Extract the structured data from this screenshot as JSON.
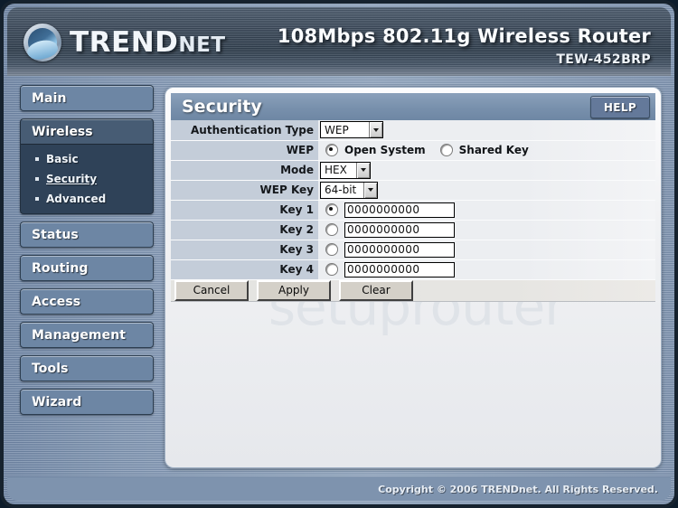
{
  "header": {
    "brand_primary": "TREND",
    "brand_secondary": "NET",
    "product_title": "108Mbps 802.11g Wireless Router",
    "model": "TEW-452BRP"
  },
  "sidebar": {
    "items": [
      {
        "label": "Main",
        "type": "button"
      },
      {
        "label": "Wireless",
        "type": "group",
        "children": [
          {
            "label": "Basic",
            "active": false
          },
          {
            "label": "Security",
            "active": true
          },
          {
            "label": "Advanced",
            "active": false
          }
        ]
      },
      {
        "label": "Status",
        "type": "button"
      },
      {
        "label": "Routing",
        "type": "button"
      },
      {
        "label": "Access",
        "type": "button"
      },
      {
        "label": "Management",
        "type": "button"
      },
      {
        "label": "Tools",
        "type": "button"
      },
      {
        "label": "Wizard",
        "type": "button"
      }
    ]
  },
  "panel": {
    "title": "Security",
    "help_label": "HELP",
    "watermark": "setuprouter",
    "rows": {
      "auth_type": {
        "label": "Authentication Type",
        "value": "WEP"
      },
      "wep": {
        "label": "WEP",
        "options": [
          {
            "label": "Open System",
            "selected": true
          },
          {
            "label": "Shared Key",
            "selected": false
          }
        ]
      },
      "mode": {
        "label": "Mode",
        "value": "HEX"
      },
      "wep_key": {
        "label": "WEP Key",
        "value": "64-bit"
      },
      "keys": [
        {
          "label": "Key 1",
          "value": "0000000000",
          "selected": true
        },
        {
          "label": "Key 2",
          "value": "0000000000",
          "selected": false
        },
        {
          "label": "Key 3",
          "value": "0000000000",
          "selected": false
        },
        {
          "label": "Key 4",
          "value": "0000000000",
          "selected": false
        }
      ]
    },
    "buttons": [
      {
        "label": "Cancel"
      },
      {
        "label": "Apply"
      },
      {
        "label": "Clear"
      }
    ]
  },
  "footer": {
    "copyright": "Copyright © 2006 TRENDnet. All Rights Reserved."
  },
  "colors": {
    "frame_border": "#16222e",
    "body_blue": "#7d93b0",
    "panel_header": "#7890ac",
    "label_cell": "#c4cdd9",
    "nav_active": "#2f4258"
  }
}
